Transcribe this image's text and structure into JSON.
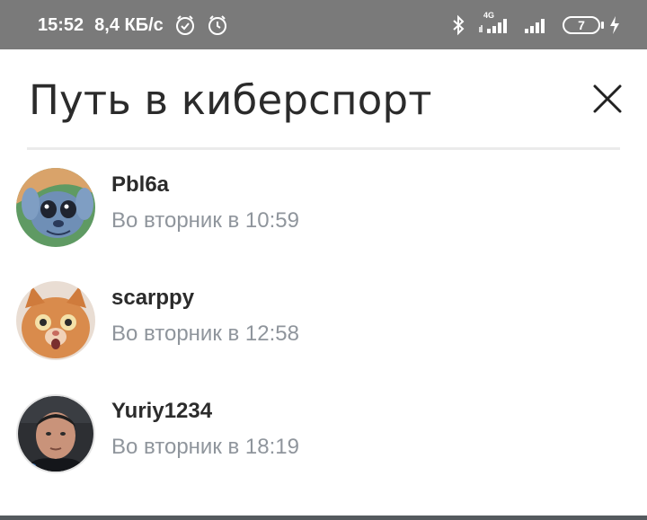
{
  "status_bar": {
    "time": "15:52",
    "net_speed": "8,4 КБ/с",
    "network_type": "4G",
    "battery_level": "7",
    "icons": [
      "do-not-disturb-icon",
      "alarm-icon",
      "bluetooth-icon",
      "signal-4g-icon",
      "signal-icon",
      "battery-icon",
      "charging-icon"
    ]
  },
  "header": {
    "title": "Путь в киберспорт",
    "close_icon": "close-icon"
  },
  "viewers": [
    {
      "name": "Pbl6a",
      "time": "Во вторник в 10:59",
      "avatar": "stitch-cartoon-avatar"
    },
    {
      "name": "scarppy",
      "time": "Во вторник в 12:58",
      "avatar": "ginger-cat-avatar"
    },
    {
      "name": "Yuriy1234",
      "time": "Во вторник в 18:19",
      "avatar": "man-portrait-avatar"
    }
  ],
  "colors": {
    "status_bar_bg": "#7a7a7a",
    "title_text": "#2b2b2b",
    "secondary_text": "#8f959c",
    "divider": "#ebebeb"
  }
}
